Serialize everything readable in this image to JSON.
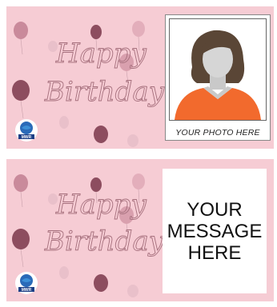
{
  "cards": [
    {
      "art": {
        "line1": "Happy",
        "line2": "Birthday"
      },
      "logo": {
        "text": "MWR"
      },
      "photo": {
        "caption": "YOUR PHOTO HERE"
      }
    },
    {
      "art": {
        "line1": "Happy",
        "line2": "Birthday"
      },
      "logo": {
        "text": "MWR"
      },
      "message": {
        "lines": [
          "YOUR",
          "MESSAGE",
          "HERE"
        ]
      }
    }
  ],
  "colors": {
    "background": "#f6ccd4",
    "balloon": "#a86b7c",
    "script": "#b07a86",
    "shirt": "#f26a2d",
    "hair": "#5a4636"
  },
  "icons": [
    "balloon-icon",
    "person-silhouette-icon",
    "globe-logo-icon"
  ]
}
